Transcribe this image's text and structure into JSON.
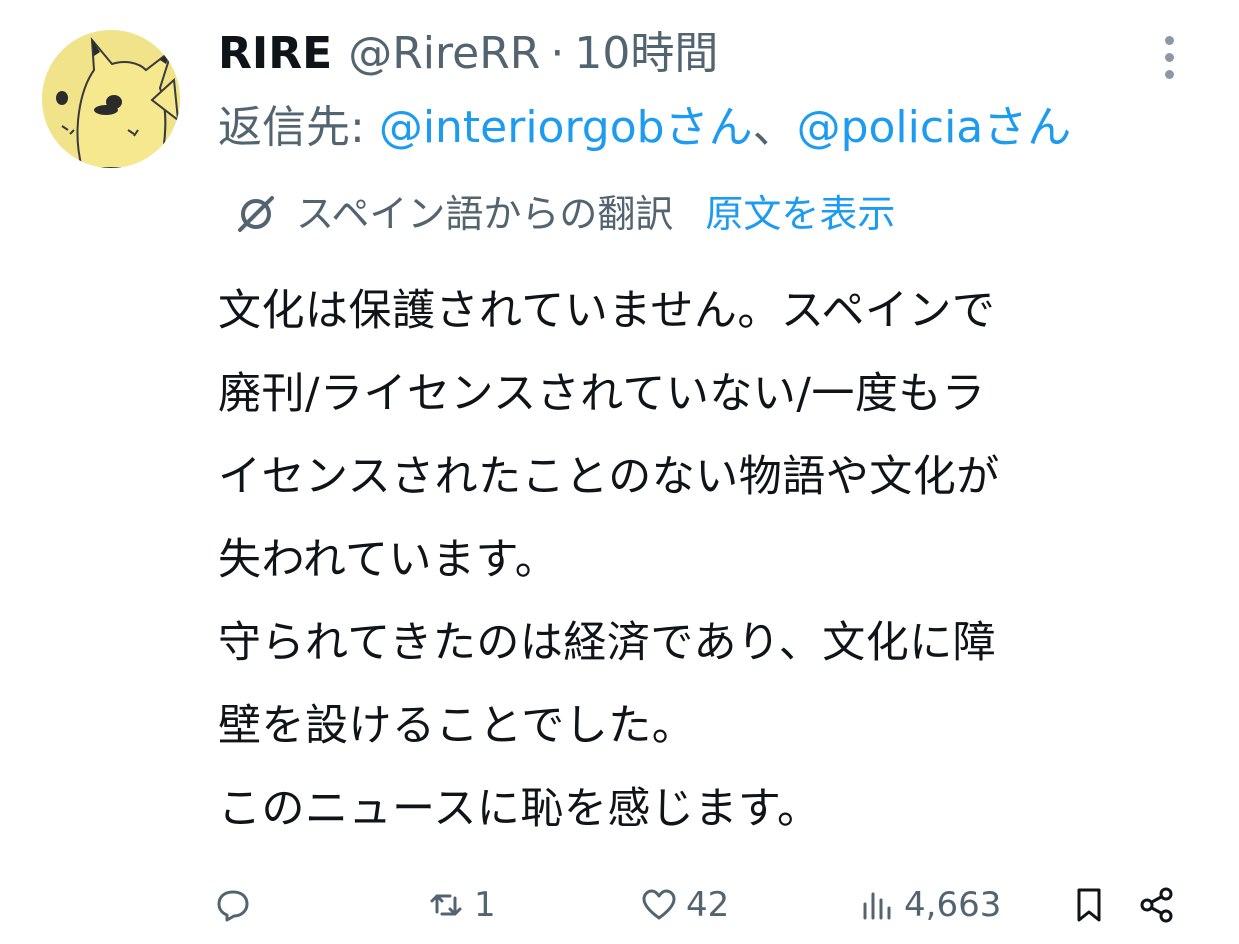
{
  "tweet": {
    "display_name": "RIRE",
    "handle": "@RireRR",
    "separator": "·",
    "time": "10時間",
    "reply_prefix": "返信先: ",
    "reply_to": [
      {
        "text": "@interiorgob"
      },
      {
        "text": "@policia"
      }
    ],
    "reply_suffix": "さん",
    "reply_joiner": "、",
    "translation_label": "スペイン語からの翻訳",
    "show_original_label": "原文を表示",
    "body_lines": [
      "文化は保護されていません。スペインで",
      "廃刊/ライセンスされていない/一度もラ",
      "イセンスされたことのない物語や文化が",
      "失われています。",
      "守られてきたのは経済であり、文化に障",
      "壁を設けることでした。",
      "このニュースに恥を感じます。"
    ]
  },
  "actions": {
    "reply_count": "",
    "retweet_count": "1",
    "like_count": "42",
    "view_count": "4,663"
  },
  "colors": {
    "text": "#0f1419",
    "secondary": "#536471",
    "link": "#1d9bf0",
    "avatar_bg": "#f0e38a"
  },
  "icons": {
    "more": "more-vertical-icon",
    "translate": "translate-icon",
    "reply": "reply-icon",
    "retweet": "retweet-icon",
    "like": "heart-icon",
    "views": "views-icon",
    "bookmark": "bookmark-icon",
    "share": "share-icon"
  }
}
